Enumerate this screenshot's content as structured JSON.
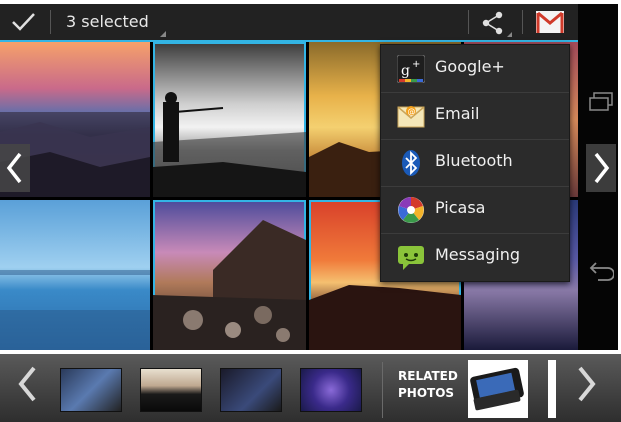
{
  "action_bar": {
    "selection_title": "3 selected",
    "accent_color": "#33b5e5"
  },
  "icons": {
    "done": "check-icon",
    "share": "share-icon",
    "gmail": "gmail-icon",
    "recents": "recent-apps-icon",
    "back": "back-icon"
  },
  "photos": [
    {
      "id": "photo-1",
      "selected": false
    },
    {
      "id": "photo-2",
      "selected": true
    },
    {
      "id": "photo-3",
      "selected": false
    },
    {
      "id": "photo-4",
      "selected": false
    },
    {
      "id": "photo-5",
      "selected": false
    },
    {
      "id": "photo-6",
      "selected": true
    },
    {
      "id": "photo-7",
      "selected": true
    },
    {
      "id": "photo-8",
      "selected": false
    }
  ],
  "share_menu": {
    "items": [
      {
        "label": "Google+",
        "icon": "google-plus-icon"
      },
      {
        "label": "Email",
        "icon": "email-icon"
      },
      {
        "label": "Bluetooth",
        "icon": "bluetooth-icon"
      },
      {
        "label": "Picasa",
        "icon": "picasa-icon"
      },
      {
        "label": "Messaging",
        "icon": "messaging-icon"
      }
    ]
  },
  "carousel": {
    "related_label_line1": "RELATED",
    "related_label_line2": "PHOTOS"
  }
}
